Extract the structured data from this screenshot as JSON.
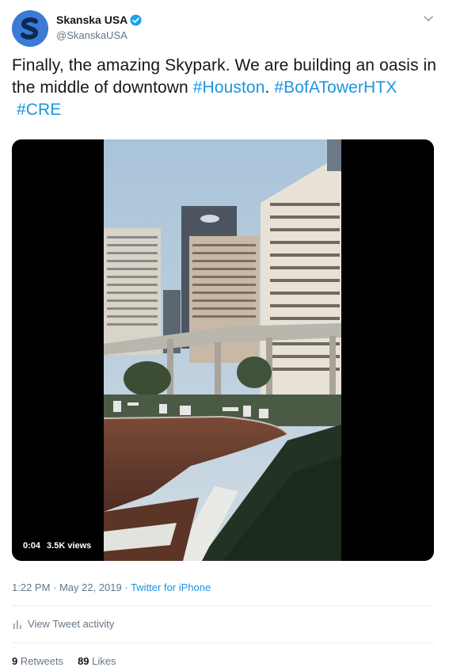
{
  "user": {
    "display_name": "Skanska USA",
    "handle": "@SkanskaUSA",
    "avatar_letter": "S",
    "verified": true
  },
  "tweet": {
    "text_plain": "Finally, the amazing Skypark. We are building an oasis in the middle of downtown ",
    "hashtag_1": "#Houston",
    "text_sep": ". ",
    "hashtag_2": "#BofATowerHTX",
    "hashtag_3": "#CRE"
  },
  "video": {
    "time": "0:04",
    "views": "3.5K views"
  },
  "meta": {
    "time": "1:22 PM · May 22, 2019 · ",
    "source": "Twitter for iPhone"
  },
  "activity": {
    "label": "View Tweet activity"
  },
  "stats": {
    "retweets_count": "9",
    "retweets_label": "Retweets",
    "likes_count": "89",
    "likes_label": "Likes"
  },
  "colors": {
    "link": "#1b95e0",
    "secondary": "#657786",
    "divider": "#e6ecf0"
  },
  "icons": [
    "verified-icon",
    "caret-down-icon",
    "analytics-icon"
  ]
}
